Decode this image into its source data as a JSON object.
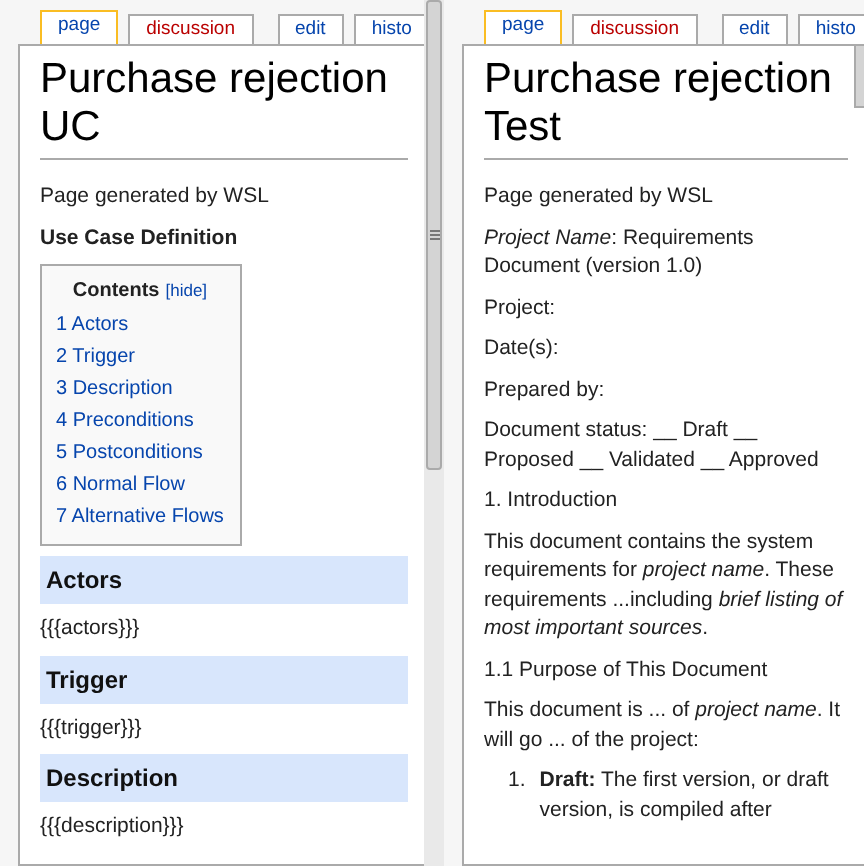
{
  "panes": [
    {
      "tabs": [
        {
          "label": "page",
          "selected": true,
          "missing": false
        },
        {
          "label": "discussion",
          "selected": false,
          "missing": true
        },
        {
          "label": "edit",
          "selected": false,
          "missing": false
        },
        {
          "label": "histo",
          "selected": false,
          "missing": false
        }
      ],
      "title": "Purchase rejection UC",
      "blocks": [
        {
          "kind": "paragraph",
          "text": "Page generated by WSL"
        },
        {
          "kind": "strong",
          "text": "Use Case Definition"
        },
        {
          "kind": "toc",
          "title": "Contents",
          "toggle": "[hide]",
          "items": [
            "1 Actors",
            "2 Trigger",
            "3 Description",
            "4 Preconditions",
            "5 Postconditions",
            "6 Normal Flow",
            "7 Alternative Flows"
          ]
        },
        {
          "kind": "section",
          "text": "Actors"
        },
        {
          "kind": "paragraph",
          "text": "{{{actors}}}"
        },
        {
          "kind": "section",
          "text": "Trigger"
        },
        {
          "kind": "paragraph",
          "text": "{{{trigger}}}"
        },
        {
          "kind": "section",
          "text": "Description"
        },
        {
          "kind": "paragraph",
          "text": "{{{description}}}"
        }
      ]
    },
    {
      "tabs": [
        {
          "label": "page",
          "selected": true,
          "missing": false
        },
        {
          "label": "discussion",
          "selected": false,
          "missing": true
        },
        {
          "label": "edit",
          "selected": false,
          "missing": false
        },
        {
          "label": "histo",
          "selected": false,
          "missing": false
        }
      ],
      "title": "Purchase rejection Test",
      "blocks": [
        {
          "kind": "paragraph",
          "text": "Page generated by WSL"
        },
        {
          "kind": "paragraph",
          "text": "*Project Name*: Requirements Document (version 1.0)"
        },
        {
          "kind": "paragraph",
          "text": "Project:"
        },
        {
          "kind": "paragraph",
          "text": "Date(s):"
        },
        {
          "kind": "paragraph",
          "text": "Prepared by:"
        },
        {
          "kind": "paragraph",
          "text": "Document status: __ Draft __ Proposed __ Validated __ Approved"
        },
        {
          "kind": "paragraph",
          "text": "1. Introduction"
        },
        {
          "kind": "paragraph",
          "text": "This document contains the system requirements for *project name*. These requirements ...including *brief listing of most important sources*."
        },
        {
          "kind": "paragraph",
          "text": "1.1 Purpose of This Document"
        },
        {
          "kind": "paragraph",
          "text": "This document is ... of *project name*. It will go ... of the project:"
        },
        {
          "kind": "numbered",
          "number": "1.",
          "text": "**Draft:** The first version, or draft version, is compiled after"
        }
      ]
    }
  ]
}
